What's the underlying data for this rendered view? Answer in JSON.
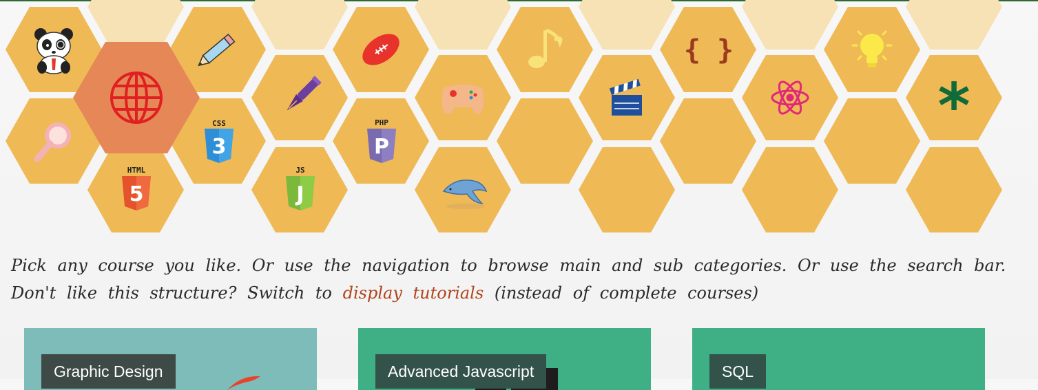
{
  "intro": {
    "line1": "Pick any course you like. Or use the navigation to browse main and sub categories. Or use the search bar.",
    "line2_before": "Don't like this structure? Switch to",
    "line2_link": "display tutorials",
    "line2_after": "(instead of complete courses)"
  },
  "hex_icons": {
    "css_label": "CSS",
    "css_glyph": "3",
    "html_label": "HTML",
    "html_glyph": "5",
    "js_label": "JS",
    "js_glyph": "J",
    "php_label": "PHP",
    "php_glyph": "P",
    "braces": "{ }",
    "asterisk": "*"
  },
  "cards": [
    {
      "label": "Graphic Design"
    },
    {
      "label": "Advanced Javascript"
    },
    {
      "label": "SQL"
    }
  ],
  "colors": {
    "hex_full": "#efb955",
    "hex_pale": "#f7e2b6",
    "hex_active": "#e68758",
    "link": "#b1441d",
    "top_line": "#2d6a2f"
  }
}
